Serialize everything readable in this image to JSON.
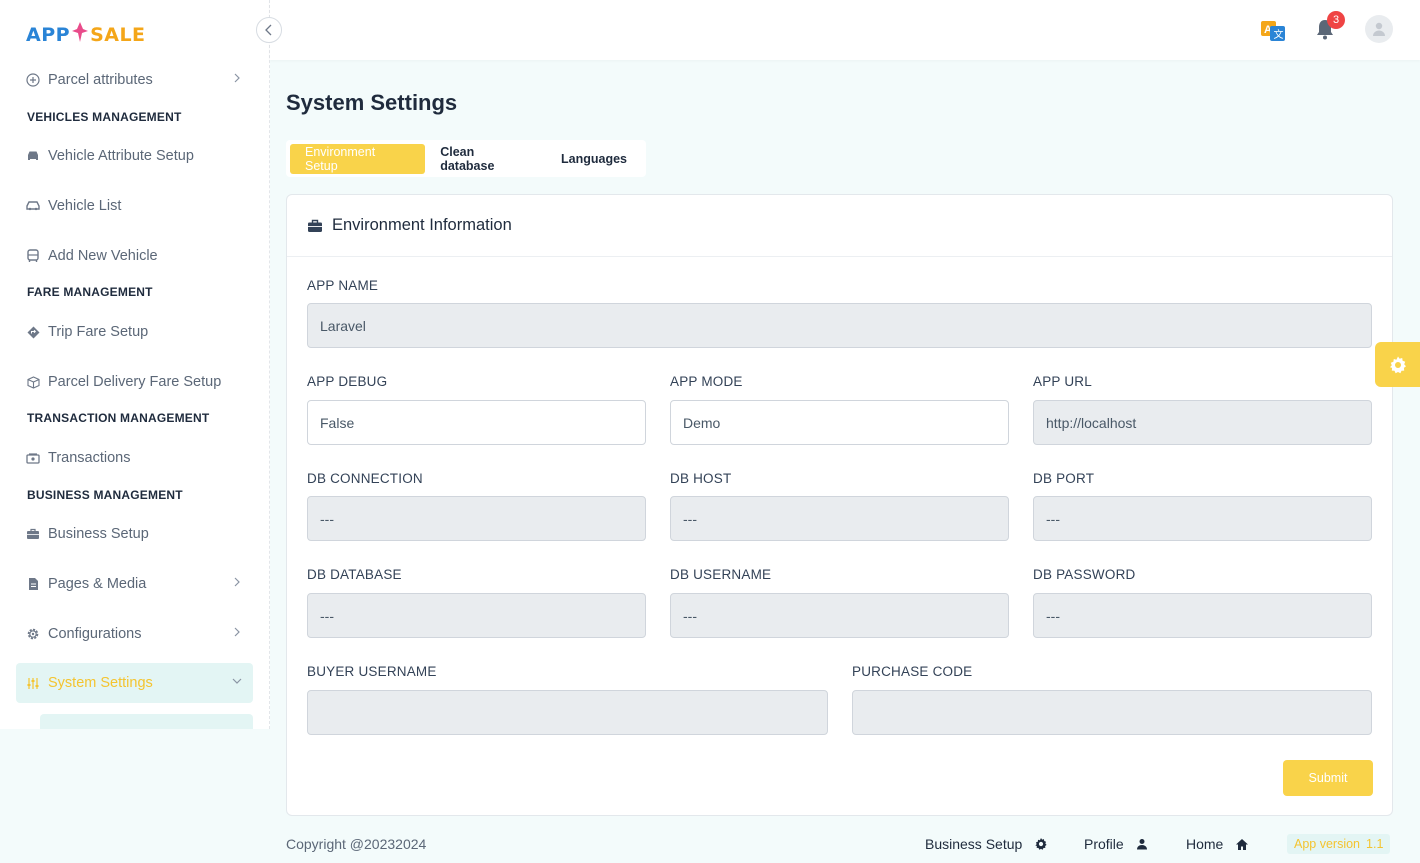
{
  "app": {
    "logo_part1": "APP",
    "logo_part2": "SALE",
    "logo_colors": {
      "app": "#2a84d6",
      "sale": "#f4a619",
      "accent": "#e94b8a"
    }
  },
  "sidebar": {
    "items": [
      {
        "label": "Parcel attributes",
        "icon": "plus-circle-icon",
        "has_chevron": true
      },
      {
        "section": "VEHICLES MANAGEMENT"
      },
      {
        "label": "Vehicle Attribute Setup",
        "icon": "car-front-icon"
      },
      {
        "label": "Vehicle List",
        "icon": "car-icon"
      },
      {
        "label": "Add New Vehicle",
        "icon": "bus-icon"
      },
      {
        "section": "FARE MANAGEMENT"
      },
      {
        "label": "Trip Fare Setup",
        "icon": "diamond-direction-icon"
      },
      {
        "label": "Parcel Delivery Fare Setup",
        "icon": "box-icon"
      },
      {
        "section": "TRANSACTION MANAGEMENT"
      },
      {
        "label": "Transactions",
        "icon": "cash-icon"
      },
      {
        "section": "BUSINESS MANAGEMENT"
      },
      {
        "label": "Business Setup",
        "icon": "briefcase-icon"
      },
      {
        "label": "Pages & Media",
        "icon": "pages-icon",
        "has_chevron": true
      },
      {
        "label": "Configurations",
        "icon": "gear-icon",
        "has_chevron": true
      },
      {
        "label": "System Settings",
        "icon": "sliders-icon",
        "has_chevron": true,
        "active": true
      }
    ]
  },
  "header": {
    "notification_count": "3"
  },
  "main": {
    "page_title": "System Settings",
    "tabs": [
      {
        "label": "Environment Setup",
        "active": true
      },
      {
        "label": "Clean database"
      },
      {
        "label": "Languages"
      }
    ],
    "card_title": "Environment Information",
    "fields": {
      "app_name": {
        "label": "APP NAME",
        "value": "Laravel"
      },
      "app_debug": {
        "label": "APP DEBUG",
        "value": "False"
      },
      "app_mode": {
        "label": "APP MODE",
        "value": "Demo"
      },
      "app_url": {
        "label": "APP URL",
        "value": "http://localhost"
      },
      "db_connection": {
        "label": "DB CONNECTION",
        "value": "---"
      },
      "db_host": {
        "label": "DB HOST",
        "value": "---"
      },
      "db_port": {
        "label": "DB PORT",
        "value": "---"
      },
      "db_database": {
        "label": "DB DATABASE",
        "value": "---"
      },
      "db_username": {
        "label": "DB USERNAME",
        "value": "---"
      },
      "db_password": {
        "label": "DB PASSWORD",
        "value": "---"
      },
      "buyer_username": {
        "label": "BUYER USERNAME",
        "value": ""
      },
      "purchase_code": {
        "label": "PURCHASE CODE",
        "value": ""
      }
    },
    "submit_label": "Submit"
  },
  "footer": {
    "copyright": "Copyright @20232024",
    "links": [
      {
        "label": "Business Setup",
        "icon": "gear-icon"
      },
      {
        "label": "Profile",
        "icon": "user-icon"
      },
      {
        "label": "Home",
        "icon": "home-icon"
      }
    ],
    "version_label": "App version",
    "version_number": "1.1"
  },
  "colors": {
    "accent": "#f9d34a",
    "active_bg": "#e3f5f4",
    "page_bg": "#f3fbfb",
    "badge": "#ef4444"
  }
}
